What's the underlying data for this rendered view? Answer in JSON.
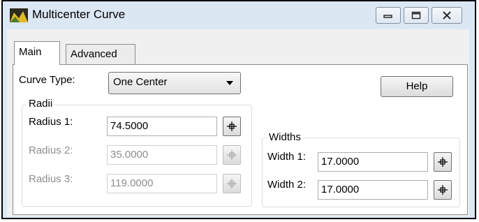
{
  "window": {
    "title": "Multicenter Curve",
    "icon": "app-icon",
    "controls": [
      "minimize-icon",
      "maximize-icon",
      "close-icon"
    ]
  },
  "tabs": [
    {
      "label": "Main",
      "selected": true
    },
    {
      "label": "Advanced",
      "selected": false
    }
  ],
  "main": {
    "curve_type_label": "Curve Type:",
    "curve_type_value": "One Center",
    "help_label": "Help",
    "radii": {
      "label": "Radii",
      "rows": [
        {
          "label": "Radius 1:",
          "value": "74.5000",
          "enabled": true
        },
        {
          "label": "Radius 2:",
          "value": "35.0000",
          "enabled": false
        },
        {
          "label": "Radius 3:",
          "value": "119.0000",
          "enabled": false
        }
      ]
    },
    "widths": {
      "label": "Widths",
      "rows": [
        {
          "label": "Width 1:",
          "value": "17.0000",
          "enabled": true
        },
        {
          "label": "Width 2:",
          "value": "17.0000",
          "enabled": true
        }
      ]
    }
  },
  "colors": {
    "titlebar": "#dce7f4",
    "disabled_text": "#8d8d8d"
  }
}
